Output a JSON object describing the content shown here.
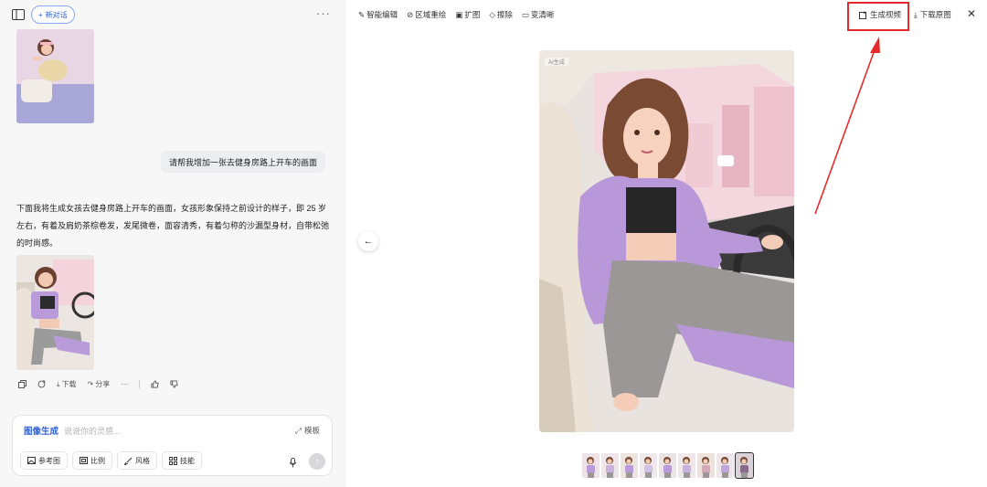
{
  "left": {
    "new_chat_label": "新对话",
    "user_message": "请帮我增加一张去健身房路上开车的画面",
    "ai_message": "下面我将生成女孩去健身房路上开车的画面，女孩形象保持之前设计的样子，即 25 岁左右，有着及肩奶茶棕卷发，发尾微卷，面容清秀，有着匀称的沙漏型身材，自带松弛的时尚感。",
    "actions": {
      "download": "下载",
      "share": "分享"
    },
    "composer": {
      "mode": "图像生成",
      "placeholder": "说说你的灵感...",
      "template": "模板",
      "chips": [
        "参考图",
        "比例",
        "风格",
        "技能"
      ]
    }
  },
  "right": {
    "toolbar": [
      "智能编辑",
      "区域重绘",
      "扩图",
      "擦除",
      "变清晰"
    ],
    "generate_video": "生成视频",
    "download_original": "下载原图",
    "watermark": "AI生成",
    "thumbnails_count": 9,
    "selected_thumbnail": 9
  },
  "colors": {
    "accent": "#2c5fdd",
    "annotation_red": "#e42b2b"
  }
}
